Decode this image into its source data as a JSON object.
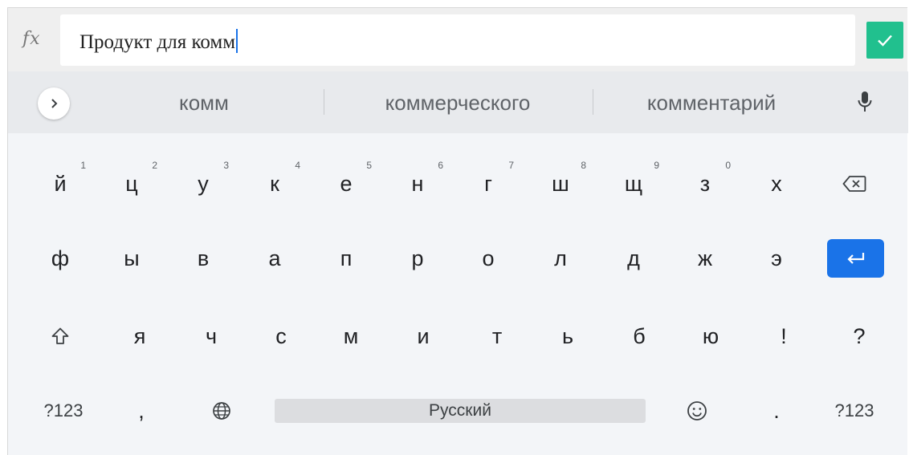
{
  "formula_bar": {
    "fx_label": "fx",
    "input_value": "Продукт для комм"
  },
  "suggestions": {
    "items": [
      "комм",
      "коммерческого",
      "комментарий"
    ]
  },
  "keyboard": {
    "row1": [
      {
        "label": "й",
        "hint": "1"
      },
      {
        "label": "ц",
        "hint": "2"
      },
      {
        "label": "у",
        "hint": "3"
      },
      {
        "label": "к",
        "hint": "4"
      },
      {
        "label": "е",
        "hint": "5"
      },
      {
        "label": "н",
        "hint": "6"
      },
      {
        "label": "г",
        "hint": "7"
      },
      {
        "label": "ш",
        "hint": "8"
      },
      {
        "label": "щ",
        "hint": "9"
      },
      {
        "label": "з",
        "hint": "0"
      },
      {
        "label": "х",
        "hint": ""
      }
    ],
    "row2": [
      "ф",
      "ы",
      "в",
      "а",
      "п",
      "р",
      "о",
      "л",
      "д",
      "ж",
      "э"
    ],
    "row3": [
      "я",
      "ч",
      "с",
      "м",
      "и",
      "т",
      "ь",
      "б",
      "ю",
      "!",
      "?"
    ],
    "bottom": {
      "symbols_left": "?123",
      "comma": ",",
      "space_label": "Русский",
      "period": ".",
      "symbols_right": "?123"
    }
  },
  "colors": {
    "accent_green": "#21c08e",
    "enter_blue": "#1a73e8",
    "caret_blue": "#1a73e8"
  },
  "icons": [
    "fx-icon",
    "checkmark-icon",
    "chevron-right-icon",
    "mic-icon",
    "backspace-icon",
    "enter-icon",
    "shift-icon",
    "globe-icon",
    "emoji-icon"
  ]
}
